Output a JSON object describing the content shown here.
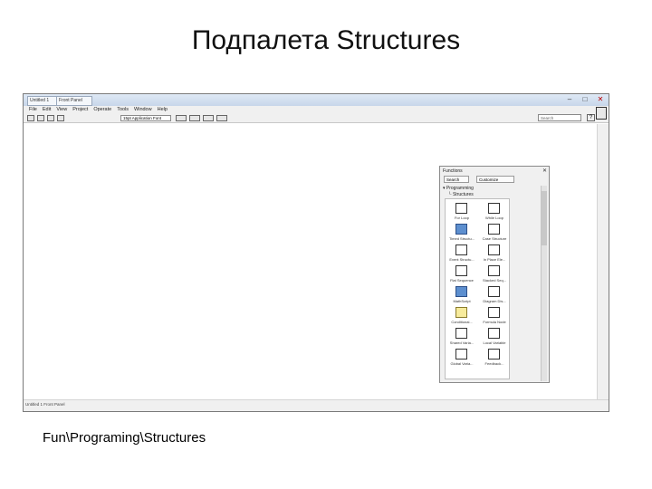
{
  "slide": {
    "title": "Подпалета Structures",
    "caption": "Fun\\Programing\\Structures"
  },
  "window": {
    "tabs": [
      "Untitled 1",
      "Front Panel"
    ],
    "controls": [
      "minimize-icon",
      "maximize-icon",
      "close-icon"
    ],
    "menu": [
      "File",
      "Edit",
      "View",
      "Project",
      "Operate",
      "Tools",
      "Window",
      "Help"
    ],
    "toolbar": {
      "font": "15pt Application Font",
      "search_placeholder": "Search",
      "help": "?"
    },
    "status": "Untitled 1 Front Panel"
  },
  "palette": {
    "title": "Functions",
    "search_label": "Search",
    "customize_label": "Customize",
    "tree": [
      "Programming",
      "Structures"
    ],
    "items": [
      {
        "label": "For Loop",
        "icon": "for-loop-icon",
        "style": "plain"
      },
      {
        "label": "While Loop",
        "icon": "while-loop-icon",
        "style": "plain"
      },
      {
        "label": "Timed Structu...",
        "icon": "timed-structure-icon",
        "style": "blue"
      },
      {
        "label": "Case Structure",
        "icon": "case-structure-icon",
        "style": "plain"
      },
      {
        "label": "Event Structu...",
        "icon": "event-structure-icon",
        "style": "plain"
      },
      {
        "label": "In Place Ele...",
        "icon": "in-place-element-icon",
        "style": "plain"
      },
      {
        "label": "Flat Sequence",
        "icon": "flat-sequence-icon",
        "style": "plain"
      },
      {
        "label": "Stacked Seq...",
        "icon": "stacked-sequence-icon",
        "style": "plain"
      },
      {
        "label": "MathScript",
        "icon": "mathscript-icon",
        "style": "blue"
      },
      {
        "label": "Diagram Dis...",
        "icon": "diagram-disable-icon",
        "style": "plain"
      },
      {
        "label": "Conditional...",
        "icon": "conditional-disable-icon",
        "style": "yellow"
      },
      {
        "label": "Formula Node",
        "icon": "formula-node-icon",
        "style": "plain"
      },
      {
        "label": "Shared Varia...",
        "icon": "shared-variable-icon",
        "style": "plain"
      },
      {
        "label": "Local Variable",
        "icon": "local-variable-icon",
        "style": "plain"
      },
      {
        "label": "Global Varia...",
        "icon": "global-variable-icon",
        "style": "plain"
      },
      {
        "label": "Feedback...",
        "icon": "feedback-node-icon",
        "style": "plain"
      }
    ]
  }
}
